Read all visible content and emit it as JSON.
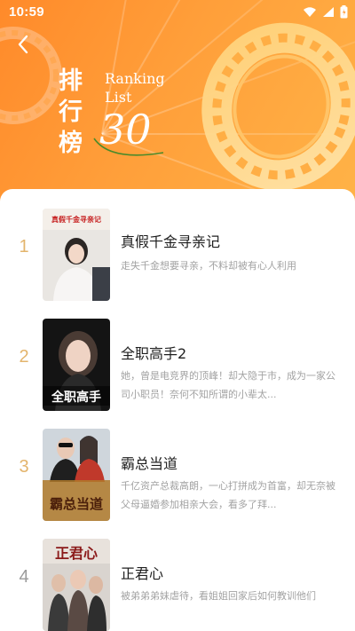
{
  "status_bar": {
    "time": "10:59"
  },
  "header": {
    "title_cn": "排行榜",
    "title_en": "Ranking List",
    "title_num": "30"
  },
  "items": [
    {
      "rank": "1",
      "title": "真假千金寻亲记",
      "description": "走失千金想要寻亲，不料却被有心人利用",
      "cover_text": "真假千金寻亲记"
    },
    {
      "rank": "2",
      "title": "全职高手2",
      "description": "她，曾是电竞界的顶峰！却大隐于市，成为一家公司小职员！奈何不知所谓的小辈太...",
      "cover_text": "全职高手"
    },
    {
      "rank": "3",
      "title": "霸总当道",
      "description": "千亿资产总裁高朗，一心打拼成为首富，却无奈被父母逼婚参加相亲大会，看多了拜...",
      "cover_text": "霸总当道"
    },
    {
      "rank": "4",
      "title": "正君心",
      "description": "被弟弟弟妹虐待，看姐姐回家后如何教训他们",
      "cover_text": "正君心"
    }
  ],
  "colors": {
    "banner_start": "#ff8a2a",
    "banner_end": "#ffb347",
    "rank_top": "#e3b46c",
    "rank_plain": "#9b9b9b"
  },
  "icons": {
    "back": "chevron-left-icon",
    "wifi": "wifi-icon",
    "signal": "signal-icon",
    "battery": "battery-icon"
  }
}
